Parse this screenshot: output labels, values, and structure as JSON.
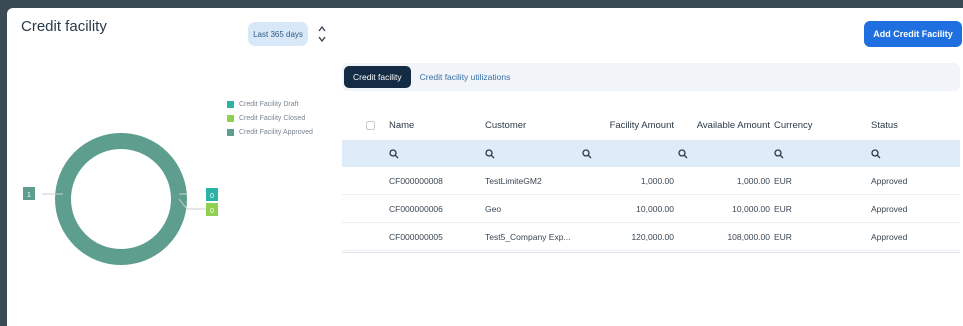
{
  "header": {
    "title": "Credit facility",
    "period_label": "Last 365 days",
    "add_button_label": "Add Credit Facility"
  },
  "chart_data": {
    "type": "pie",
    "categories": [
      "Credit Facility Draft",
      "Credit Facility Closed",
      "Credit Facility Approved"
    ],
    "values": [
      0,
      0,
      1
    ],
    "colors": [
      "#2bb3a6",
      "#8fd14f",
      "#5e9e8e"
    ],
    "legend_position": "top-right",
    "labels": [
      "0",
      "0",
      "1"
    ]
  },
  "tabs": [
    {
      "label": "Credit facility",
      "active": true
    },
    {
      "label": "Credit facility utilizations",
      "active": false
    }
  ],
  "table": {
    "columns": [
      "Name",
      "Customer",
      "Facility Amount",
      "Available Amount",
      "Currency",
      "Status"
    ],
    "rows": [
      [
        "CF000000008",
        "TestLimiteGM2",
        "1,000.00",
        "1,000.00",
        "EUR",
        "Approved"
      ],
      [
        "CF000000006",
        "Geo",
        "10,000.00",
        "10,000.00",
        "EUR",
        "Approved"
      ],
      [
        "CF000000005",
        "Test5_Company Exp...",
        "120,000.00",
        "108,000.00",
        "EUR",
        "Approved"
      ]
    ]
  },
  "colors": {
    "primary": "#1f6fe0",
    "active_tab": "#142b44",
    "filter_row": "#deebf8"
  }
}
